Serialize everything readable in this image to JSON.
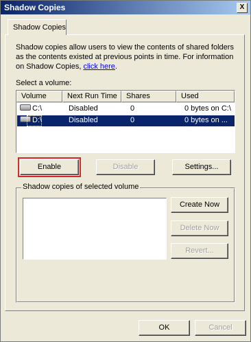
{
  "window": {
    "title": "Shadow Copies",
    "close_label": "X"
  },
  "tab": {
    "label": "Shadow Copies"
  },
  "description": {
    "text": "Shadow copies allow users to view the contents of shared folders as the contents existed at previous points in time. For information on Shadow Copies, ",
    "link": "click here",
    "suffix": "."
  },
  "volume_section": {
    "label": "Select a volume:"
  },
  "volume_table": {
    "columns": [
      "Volume",
      "Next Run Time",
      "Shares",
      "Used"
    ],
    "rows": [
      {
        "volume": "C:\\",
        "next_run_time": "Disabled",
        "shares": "0",
        "used": "0 bytes on C:\\",
        "selected": false
      },
      {
        "volume": "D:\\",
        "next_run_time": "Disabled",
        "shares": "0",
        "used": "0 bytes on ...",
        "selected": true
      }
    ]
  },
  "volume_buttons": {
    "enable": "Enable",
    "disable": "Disable",
    "settings": "Settings..."
  },
  "copies_group": {
    "title": "Shadow copies of selected volume",
    "create_now": "Create Now",
    "delete_now": "Delete Now",
    "revert": "Revert..."
  },
  "dialog_buttons": {
    "ok": "OK",
    "cancel": "Cancel"
  },
  "colors": {
    "selection": "#0a246a",
    "dialog_face": "#ece9d8",
    "link": "#0000ee",
    "highlight_outline": "#d82a2a"
  }
}
